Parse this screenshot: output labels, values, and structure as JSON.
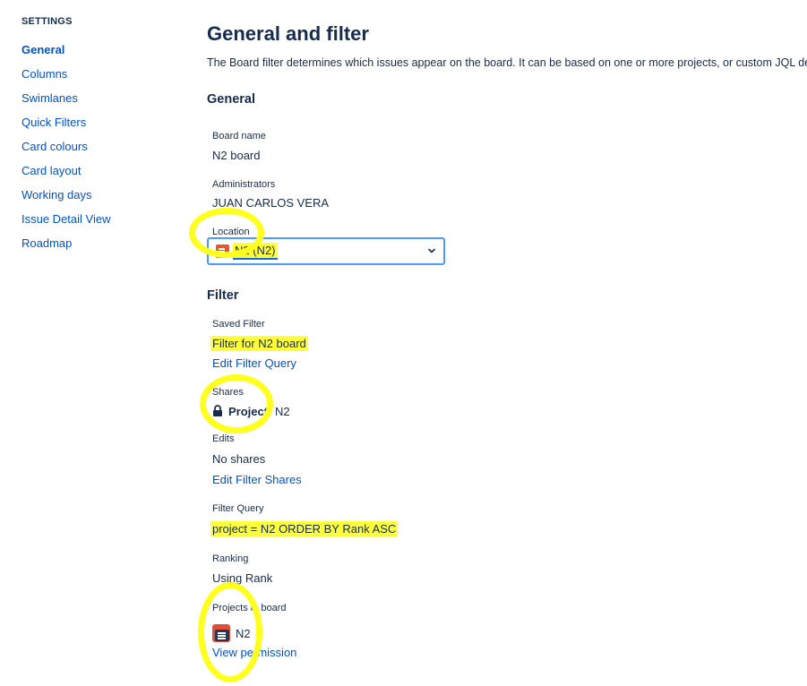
{
  "sidebar": {
    "heading": "SETTINGS",
    "items": [
      {
        "label": "General",
        "active": true
      },
      {
        "label": "Columns"
      },
      {
        "label": "Swimlanes"
      },
      {
        "label": "Quick Filters"
      },
      {
        "label": "Card colours"
      },
      {
        "label": "Card layout"
      },
      {
        "label": "Working days"
      },
      {
        "label": "Issue Detail View"
      },
      {
        "label": "Roadmap"
      }
    ]
  },
  "main": {
    "title": "General and filter",
    "description": "The Board filter determines which issues appear on the board. It can be based on one or more projects, or custom JQL de",
    "general": {
      "heading": "General",
      "board_name_label": "Board name",
      "board_name": "N2 board",
      "administrators_label": "Administrators",
      "administrators": "JUAN CARLOS VERA",
      "location_label": "Location",
      "location_value": "N2 (N2)"
    },
    "filter": {
      "heading": "Filter",
      "saved_filter_label": "Saved Filter",
      "saved_filter": "Filter for N2 board",
      "edit_filter_query": "Edit Filter Query",
      "shares_label": "Shares",
      "shares_project_prefix": "Project:",
      "shares_project": "N2",
      "edits_label": "Edits",
      "edits_value": "No shares",
      "edit_filter_shares": "Edit Filter Shares",
      "filter_query_label": "Filter Query",
      "filter_query": "project = N2 ORDER BY Rank ASC",
      "ranking_label": "Ranking",
      "ranking_value": "Using Rank",
      "projects_label": "Projects in board",
      "project_name": "N2",
      "view_permission": "View permission"
    }
  },
  "colors": {
    "link": "#0052cc",
    "text": "#172b4d",
    "highlight": "#ffff3a",
    "focus_border": "#4c9aff",
    "project_icon": "#e8562a"
  },
  "icons": [
    "project-icon",
    "lock-icon",
    "chevron-down-icon"
  ]
}
